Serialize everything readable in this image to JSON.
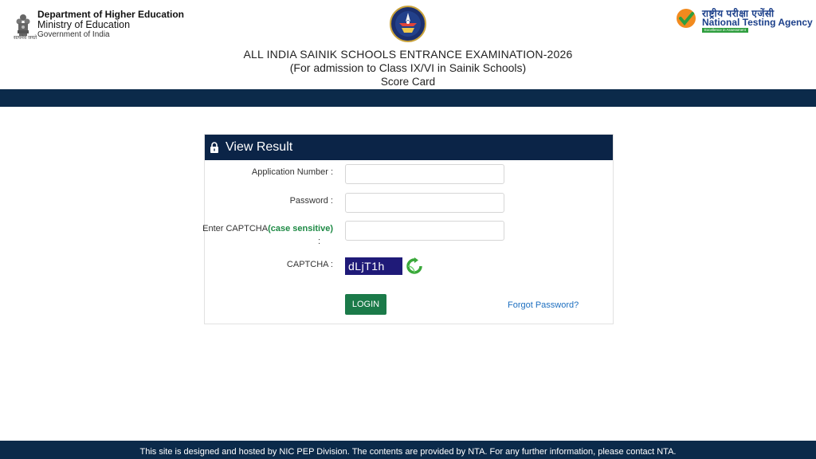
{
  "header": {
    "ministry": {
      "line1": "Department of Higher Education",
      "line2": "Ministry of Education",
      "line3": "Government of India",
      "emblem_caption": "सत्यमेव जयते"
    },
    "nta": {
      "hindi": "राष्ट्रीय परीक्षा एजेंसी",
      "english": "National Testing Agency",
      "tagline": "Excellence in Assessment"
    },
    "exam_title": {
      "line1": "ALL INDIA SAINIK SCHOOLS ENTRANCE EXAMINATION-2026",
      "line2": "(For admission to Class IX/VI in Sainik Schools)",
      "line3": "Score Card"
    }
  },
  "panel": {
    "title": "View Result",
    "fields": {
      "application_number_label": "Application Number :",
      "application_number_value": "",
      "password_label": "Password :",
      "password_value": "",
      "captcha_input_label": "Enter CAPTCHA",
      "captcha_input_note": "(case sensitive)",
      "captcha_input_colon": ":",
      "captcha_input_value": "",
      "captcha_label": "CAPTCHA :",
      "captcha_text": "dLjT1h"
    },
    "login_label": "LOGIN",
    "forgot_label": "Forgot Password?"
  },
  "footer": {
    "text": "This site is designed and hosted by NIC PEP Division. The contents are provided by NTA. For any further information, please contact NTA."
  },
  "colors": {
    "navbar": "#0b2a4a",
    "panel_header": "#0b2447",
    "login_button": "#1b7a49",
    "link": "#1d6fc0",
    "captcha_bg": "#1f1a78"
  }
}
